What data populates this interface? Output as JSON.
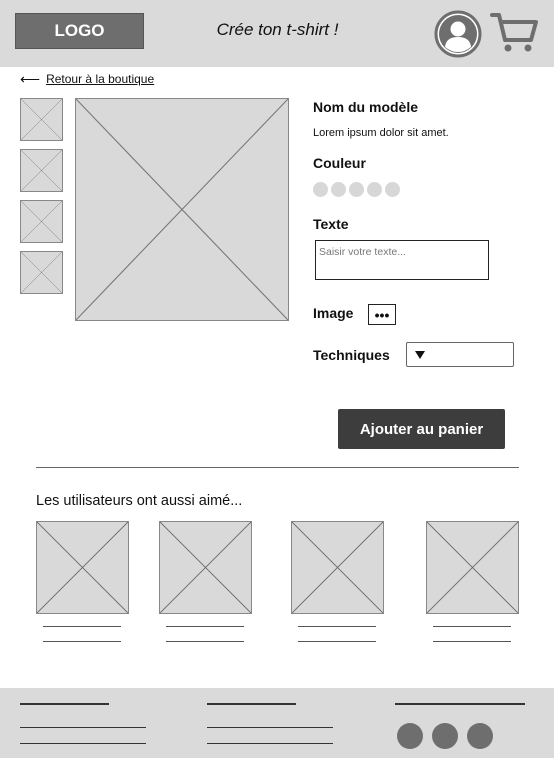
{
  "header": {
    "logo_text": "LOGO",
    "tagline": "Crée ton t-shirt !",
    "avatar_icon": "user-avatar-icon",
    "cart_icon": "shopping-cart-icon"
  },
  "nav": {
    "back_arrow": "⟵",
    "back_label": "Retour à la boutique"
  },
  "product": {
    "name_label": "Nom du modèle",
    "description": "Lorem ipsum dolor sit amet.",
    "color_label": "Couleur",
    "text_label": "Texte",
    "text_placeholder": "Saisir votre texte...",
    "image_label": "Image",
    "image_button": "•••",
    "techniques_label": "Techniques",
    "add_to_cart": "Ajouter au panier"
  },
  "related": {
    "title": "Les utilisateurs ont aussi aimé..."
  },
  "colors": {
    "header_bg": "#dadada",
    "logo_bg": "#6e6e6e",
    "cta_bg": "#3d3d3d",
    "placeholder_bg": "#d9d9d9"
  }
}
